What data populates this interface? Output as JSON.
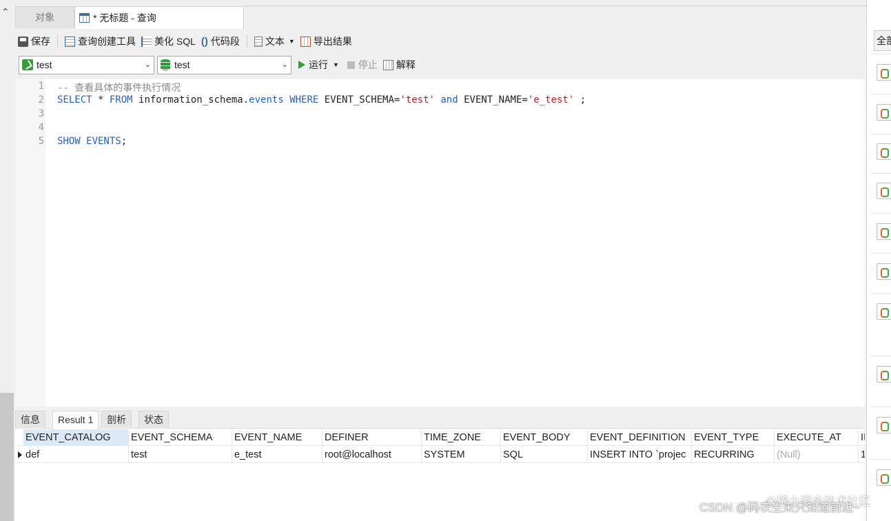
{
  "tabs": {
    "objects_label": "对象",
    "query_label": "* 无标题 - 查询"
  },
  "toolbar": {
    "save_label": "保存",
    "query_builder_label": "查询创建工具",
    "beautify_label": "美化 SQL",
    "snippet_label": "代码段",
    "text_label": "文本",
    "export_label": "导出结果"
  },
  "run_bar": {
    "connection": "test",
    "database": "test",
    "run_label": "运行",
    "stop_label": "停止",
    "explain_label": "解释"
  },
  "editor": {
    "line_numbers": [
      "1",
      "2",
      "3",
      "4",
      "5"
    ],
    "line1_comment": "-- 查看具体的事件执行情况",
    "line2": {
      "kw_select": "SELECT",
      "star": " * ",
      "kw_from": "FROM",
      "schema": " information_schema.",
      "table": "events",
      "sp1": " ",
      "kw_where": "WHERE",
      "cond1": " EVENT_SCHEMA=",
      "val1": "'test'",
      "sp2": " ",
      "kw_and": "and",
      "cond2": " EVENT_NAME=",
      "val2": "'e_test'",
      "tail": " ;"
    },
    "line5": {
      "kw": "SHOW EVENTS",
      "tail": ";"
    }
  },
  "result": {
    "tabs": [
      "信息",
      "Result 1",
      "剖析",
      "状态"
    ],
    "columns": [
      "EVENT_CATALOG",
      "EVENT_SCHEMA",
      "EVENT_NAME",
      "DEFINER",
      "TIME_ZONE",
      "EVENT_BODY",
      "EVENT_DEFINITION",
      "EVENT_TYPE",
      "EXECUTE_AT",
      "II"
    ],
    "rows": [
      [
        "def",
        "test",
        "e_test",
        "root@localhost",
        "SYSTEM",
        "SQL",
        "INSERT INTO `projec",
        "RECURRING",
        "(Null)",
        "1"
      ]
    ]
  },
  "right_panel": {
    "all_label": "全部"
  },
  "watermark": {
    "line1": "@稀土掘金技术社区",
    "line2": "CSDN @码农生来只知道前进~"
  }
}
